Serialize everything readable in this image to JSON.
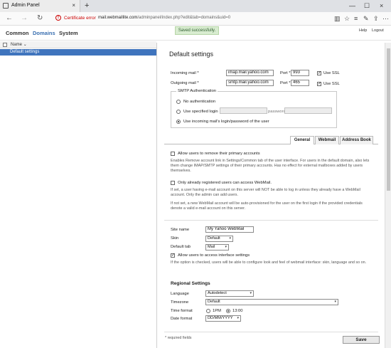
{
  "browser": {
    "tab_title": "Admin Panel",
    "tab_close": "×",
    "new_tab": "+",
    "win_min": "—",
    "win_max": "☐",
    "win_close": "×",
    "back": "←",
    "forward": "→",
    "reload": "↻",
    "cert_icon": "!",
    "cert_error": "Certificate error",
    "url_host": "mail.webmaillite.com",
    "url_path": "/adminpanel/index.php?edit&tab=domains&uid=0",
    "toolbar_icons": [
      "reading-view-icon",
      "favorite-icon",
      "hub-icon",
      "notes-icon",
      "share-icon",
      "more-icon"
    ]
  },
  "app": {
    "nav": [
      "Common",
      "Domains",
      "System"
    ],
    "toast": "Saved successfully.",
    "help": "Help",
    "logout": "Logout"
  },
  "list": {
    "header": "Name",
    "sort_icon": "⌄",
    "items": [
      "Default settings"
    ]
  },
  "form": {
    "title": "Default settings",
    "incoming_label": "Incoming mail *",
    "incoming_value": "imap.mail.yahoo.com",
    "incoming_port_label": "Port *",
    "incoming_port_value": "993",
    "incoming_ssl_label": "Use SSL",
    "outgoing_label": "Outgoing mail *",
    "outgoing_value": "smtp.mail.yahoo.com",
    "outgoing_port_label": "Port *",
    "outgoing_port_value": "465",
    "outgoing_ssl_label": "Use SSL",
    "smtp_legend": "SMTP Authentication",
    "smtp_none": "No authentication",
    "smtp_specified": "Use specified login",
    "smtp_password_label": "password:",
    "smtp_incoming": "Use incoming mail's login/password of the user",
    "tabs": [
      "General",
      "Webmail",
      "Address Book"
    ],
    "allow_remove_label": "Allow users to remove their primary accounts",
    "allow_remove_hint": "Enables Remove account link in Settings/Common tab of the user interface. For users in the default domain, also lets them change IMAP/SMTP settings of their primary accounts. Has no effect for external mailboxes added by users themselves.",
    "only_registered_label": "Only already registered users can access WebMail.",
    "only_registered_hint1": "If set, a user having e-mail account on this server will NOT be able to log in unless they already have a WebMail account. Only the admin can add users.",
    "only_registered_hint2": "If not set, a new WebMail account will be auto-provisioned for the user on the first login if the provided credentials denote a valid e-mail account on this server.",
    "site_name_label": "Site name",
    "site_name_value": "My Yahoo WebMail",
    "skin_label": "Skin",
    "skin_value": "Default",
    "default_tab_label": "Default tab",
    "default_tab_value": "Mail",
    "allow_interface_label": "Allow users to access interface settings",
    "allow_interface_hint": "If the option is checked, users will be able to configure look and feel of webmail interface: skin, language and so on.",
    "regional_heading": "Regional Settings",
    "language_label": "Language",
    "language_value": "Autodetect",
    "timezone_label": "Timezone",
    "timezone_value": "Default",
    "time_format_label": "Time format",
    "time_12": "1PM",
    "time_24": "13:00",
    "date_format_label": "Date format",
    "date_format_value": "DD/MM/YYYY",
    "required_note": "* required fields",
    "save": "Save",
    "select_arrow": "▾"
  }
}
